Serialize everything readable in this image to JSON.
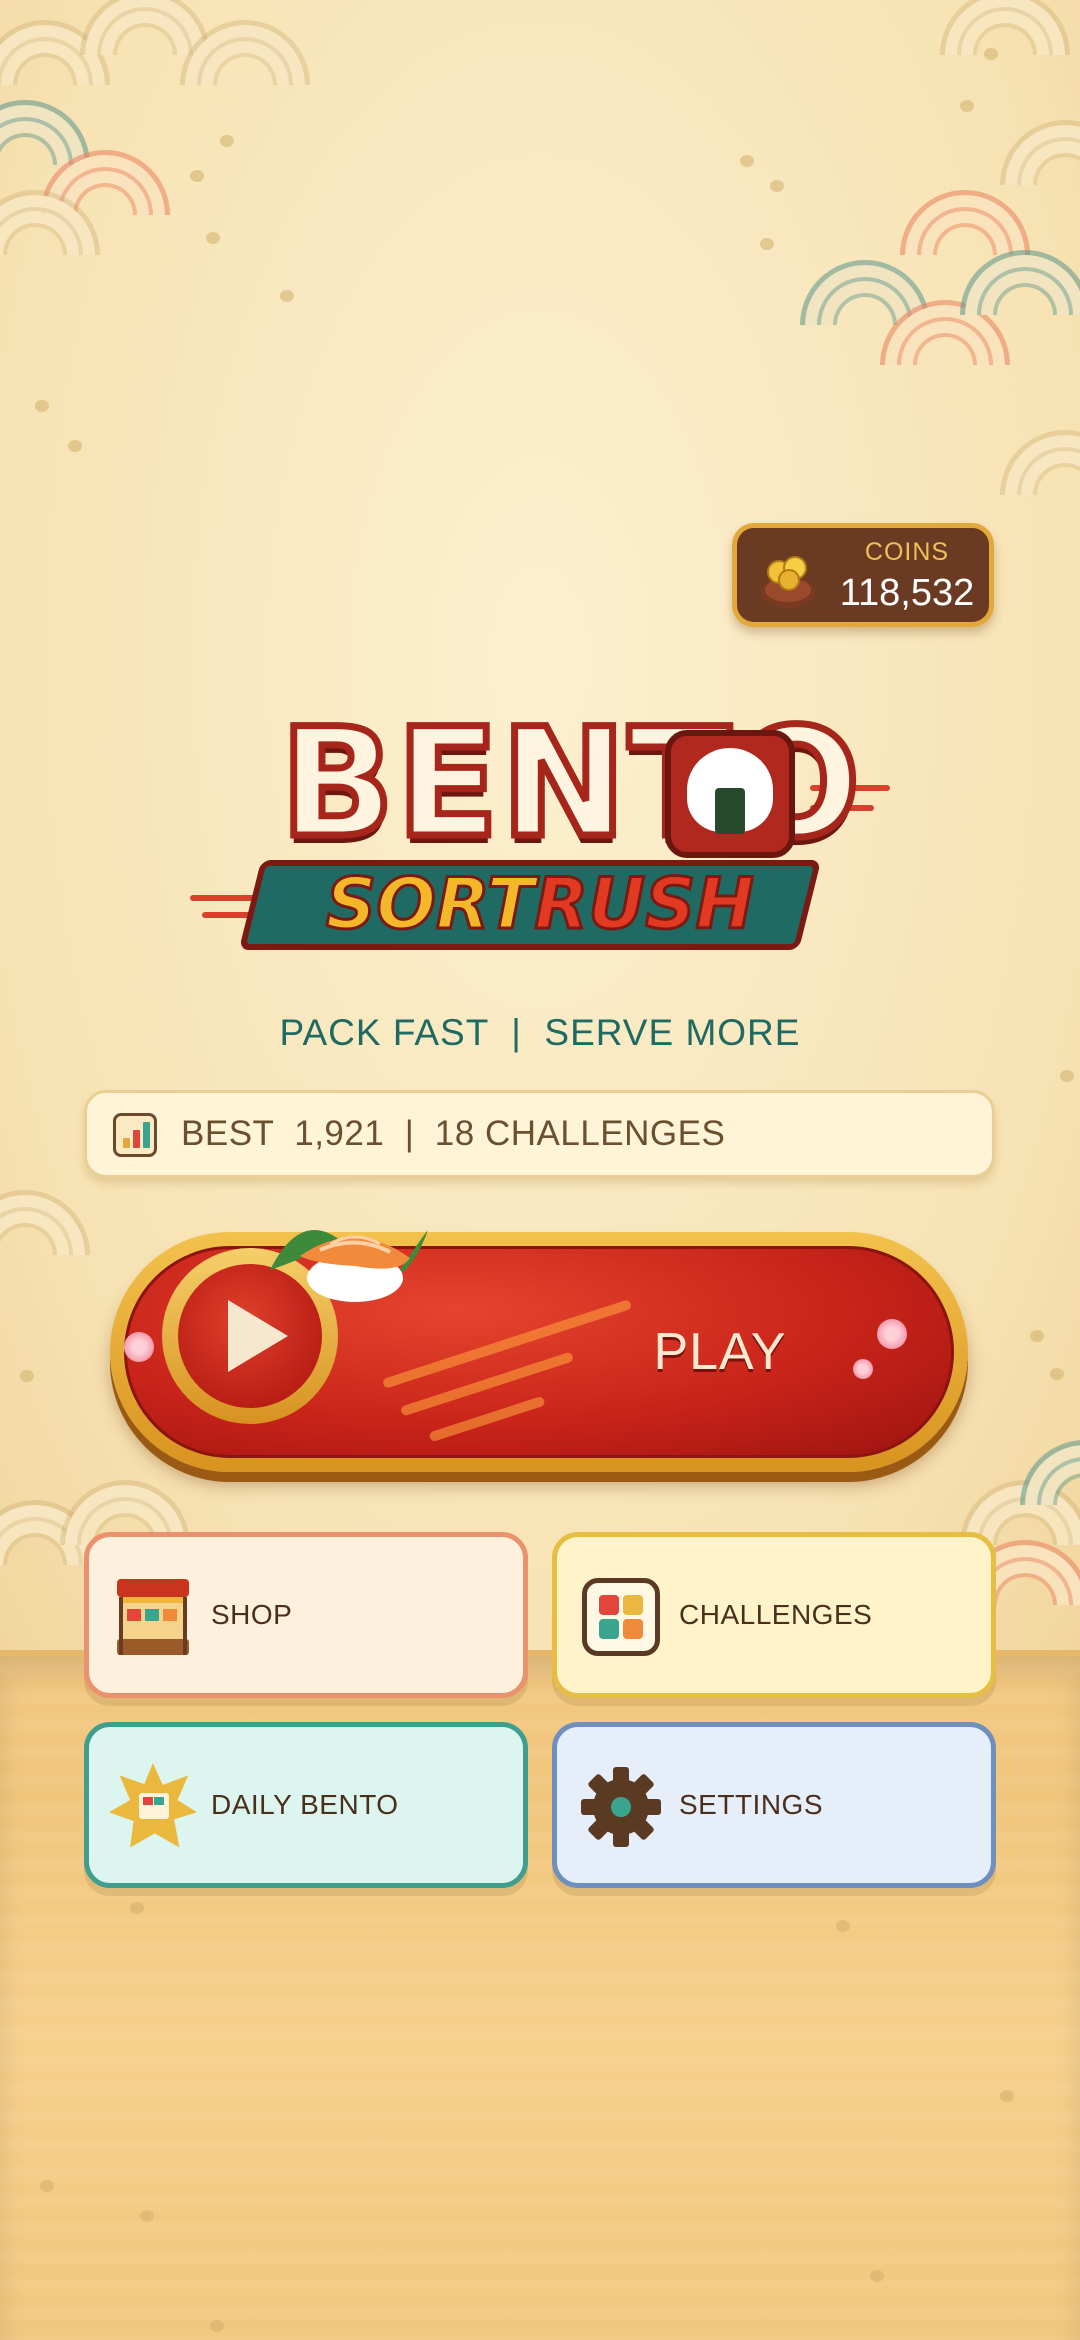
{
  "coins": {
    "label": "COINS",
    "value": "118,532",
    "icon": "coin-bag-icon"
  },
  "logo": {
    "title": "BENTO",
    "subtitle_part1": "SORT",
    "subtitle_part2": "RUSH",
    "icon": "onigiri-icon"
  },
  "tagline": "PACK FAST  |  SERVE MORE",
  "best": {
    "icon": "bar-chart-icon",
    "text": "BEST  1,921  |  18 CHALLENGES"
  },
  "play": {
    "label": "PLAY",
    "icon": "play-icon"
  },
  "menu": {
    "shop": {
      "label": "SHOP",
      "icon": "food-stall-icon"
    },
    "challenges": {
      "label": "CHALLENGES",
      "icon": "grid-icon"
    },
    "daily": {
      "label": "DAILY BENTO",
      "icon": "daily-badge-icon"
    },
    "settings": {
      "label": "SETTINGS",
      "icon": "gear-icon"
    }
  },
  "colors": {
    "accent_red": "#c9241a",
    "accent_gold": "#e2a93a",
    "teal": "#1f6a63",
    "background": "#f8e8c2"
  }
}
